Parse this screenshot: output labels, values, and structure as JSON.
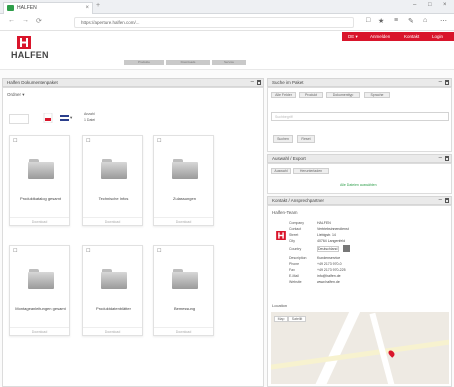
{
  "browser": {
    "tab_label": "HALFEN",
    "tab_close": "×",
    "new_tab": "+",
    "url": "https://aperture.halfen.com/...",
    "window_controls": [
      "–",
      "□",
      "×"
    ],
    "nav": {
      "back": "←",
      "forward": "→",
      "refresh": "⟳"
    },
    "toolbar_icons": [
      "□",
      "★",
      "≡",
      "✎",
      "⌂",
      "⋯"
    ]
  },
  "header": {
    "logo_text": "HALFEN",
    "util_links": [
      "DE ▾",
      "Anmelden",
      "Kontakt",
      "Login"
    ],
    "main_nav": [
      "Produkte",
      "Downloads",
      "Service"
    ]
  },
  "left_panel": {
    "title": "Halfen Dokumentenpaket",
    "filter_label": "Ordner ▾",
    "lang_selector": "▾",
    "count_label": "Anzahl",
    "count_value": "1 Datei",
    "folders": [
      {
        "name": "Produktkatalog gesamt"
      },
      {
        "name": "Technische Infos"
      },
      {
        "name": "Zulassungen"
      },
      {
        "name": "Montageanleitungen gesamt"
      },
      {
        "name": "Produktdatenblätter"
      },
      {
        "name": "Bemessung"
      }
    ],
    "folder_footer": "Download"
  },
  "search_panel": {
    "title": "Suche im Paket",
    "tabs": [
      "Alle Felder",
      "Produkt",
      "Dokumenttyp",
      "Sprache"
    ],
    "placeholder": "Suchbegriff",
    "search_button": "Suchen",
    "reset_button": "Reset"
  },
  "selection_panel": {
    "title": "Auswahl / Export",
    "buttons": [
      "Auswahl",
      "Herunterladen"
    ],
    "link": "Alle Dateien auswählen"
  },
  "contact_panel": {
    "title": "Kontakt / Ansprechpartner",
    "subtitle": "Halfen-Team",
    "rows": [
      {
        "label": "Company",
        "value": "HALFEN"
      },
      {
        "label": "Contact",
        "value": "Vertriebsinnendienst"
      },
      {
        "label": "Street",
        "value": "Liebigstr. 14"
      },
      {
        "label": "City",
        "value": "40764 Langenfeld"
      },
      {
        "label": "Country",
        "value": "Deutschland"
      },
      {
        "label": "Description",
        "value": "Kundenservice"
      },
      {
        "label": "Phone",
        "value": "+49 2173 970-0"
      },
      {
        "label": "Fax",
        "value": "+49 2173 970-225"
      },
      {
        "label": "E-Mail",
        "value": "info@halfen.de"
      },
      {
        "label": "Website",
        "value": "www.halfen.de"
      }
    ],
    "location_label": "Location",
    "map_tabs": [
      "Map",
      "Satellit"
    ]
  },
  "colors": {
    "brand_red": "#d9152b",
    "panel_header": "#eaeaea",
    "link_green": "#2e9e4a"
  }
}
